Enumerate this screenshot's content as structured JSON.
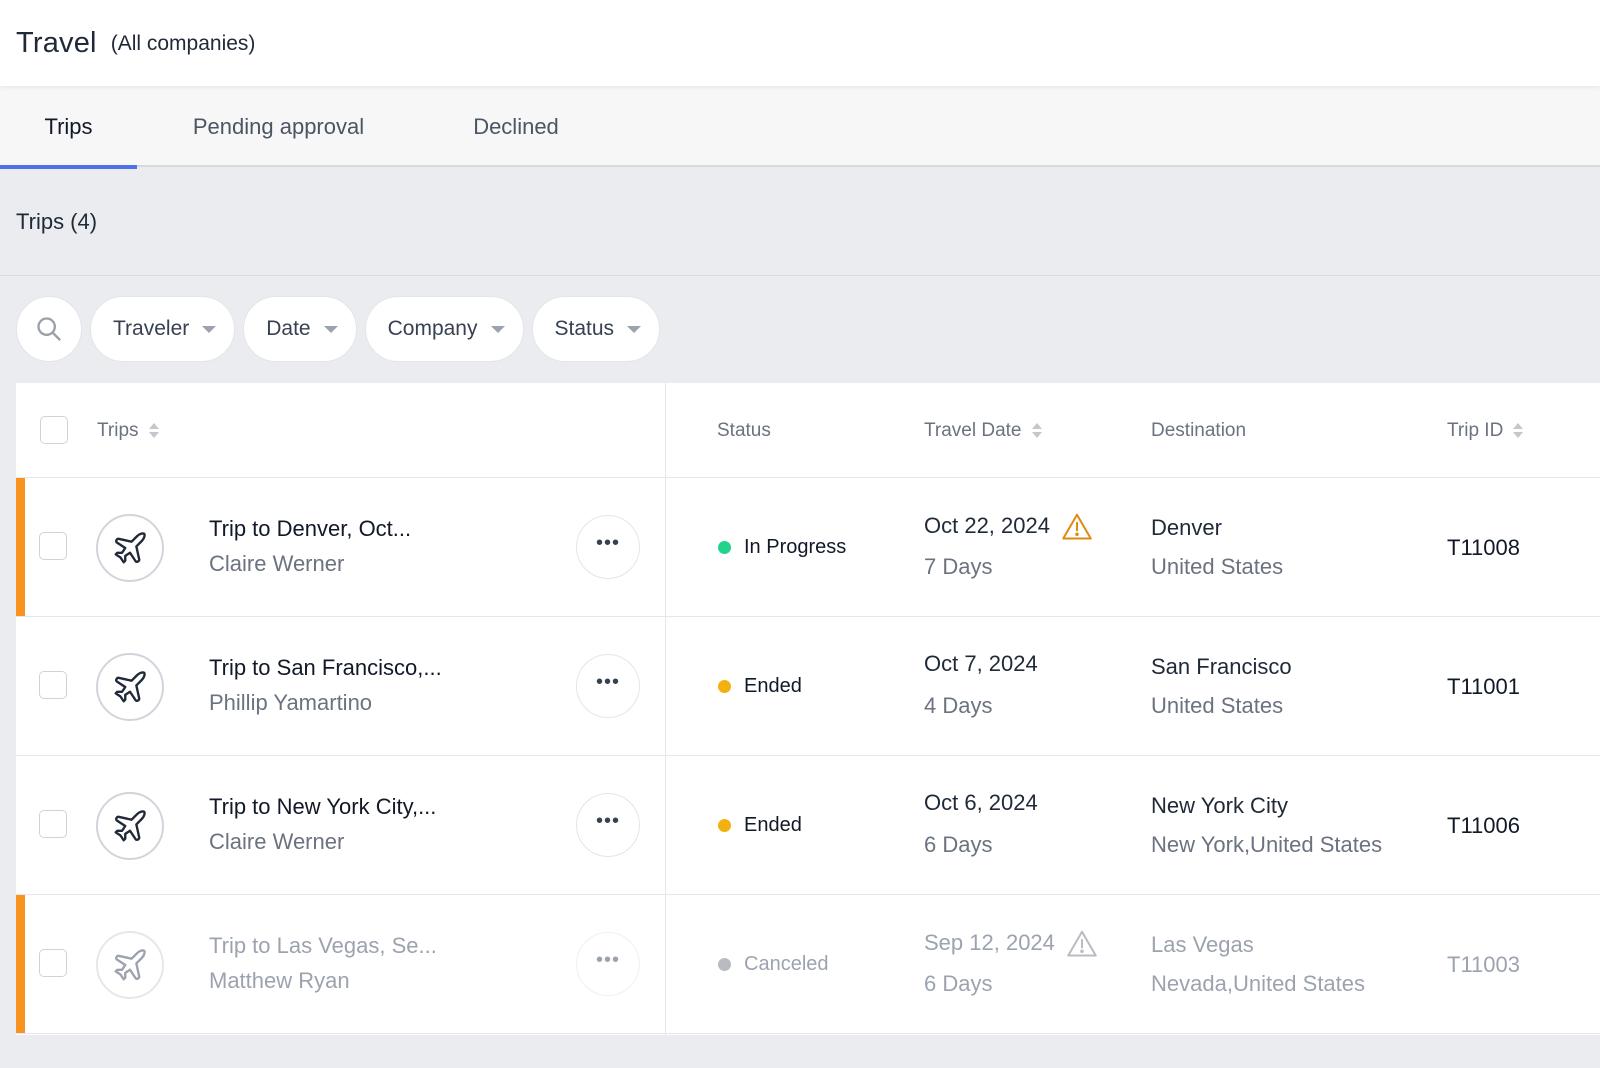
{
  "header": {
    "title": "Travel",
    "subtitle": "(All companies)"
  },
  "tabs": [
    {
      "label": "Trips",
      "active": true
    },
    {
      "label": "Pending approval",
      "active": false
    },
    {
      "label": "Declined",
      "active": false
    }
  ],
  "section": {
    "title": "Trips (4)"
  },
  "filters": {
    "search_icon": "search-icon",
    "items": [
      {
        "label": "Traveler"
      },
      {
        "label": "Date"
      },
      {
        "label": "Company"
      },
      {
        "label": "Status"
      }
    ]
  },
  "table": {
    "columns": {
      "trips": "Trips",
      "status": "Status",
      "travel_date": "Travel Date",
      "destination": "Destination",
      "trip_id": "Trip ID"
    },
    "rows": [
      {
        "title": "Trip to Denver, Oct...",
        "traveler": "Claire Werner",
        "status": "In Progress",
        "status_color": "#22d38a",
        "date": "Oct 22, 2024",
        "days": "7 Days",
        "warning": true,
        "city": "Denver",
        "country": "United States",
        "trip_id": "T11008",
        "highlight": true,
        "faded": false
      },
      {
        "title": "Trip to San Francisco,...",
        "traveler": "Phillip Yamartino",
        "status": "Ended",
        "status_color": "#f2b10e",
        "date": "Oct 7, 2024",
        "days": "4 Days",
        "warning": false,
        "city": "San Francisco",
        "country": "United States",
        "trip_id": "T11001",
        "highlight": false,
        "faded": false
      },
      {
        "title": "Trip to New York City,...",
        "traveler": "Claire Werner",
        "status": "Ended",
        "status_color": "#f2b10e",
        "date": "Oct 6, 2024",
        "days": "6 Days",
        "warning": false,
        "city": "New York City",
        "country": "New York,United States",
        "trip_id": "T11006",
        "highlight": false,
        "faded": false
      },
      {
        "title": "Trip to Las Vegas, Se...",
        "traveler": "Matthew Ryan",
        "status": "Canceled",
        "status_color": "#b8bcc2",
        "date": "Sep 12, 2024",
        "days": "6 Days",
        "warning": true,
        "city": "Las Vegas",
        "country": "Nevada,United States",
        "trip_id": "T11003",
        "highlight": true,
        "faded": true
      }
    ]
  },
  "colors": {
    "accent_tab": "#4f72e8",
    "row_highlight": "#f7931e",
    "warning_active": "#e08a12",
    "warning_faded": "#b8bcc2"
  }
}
